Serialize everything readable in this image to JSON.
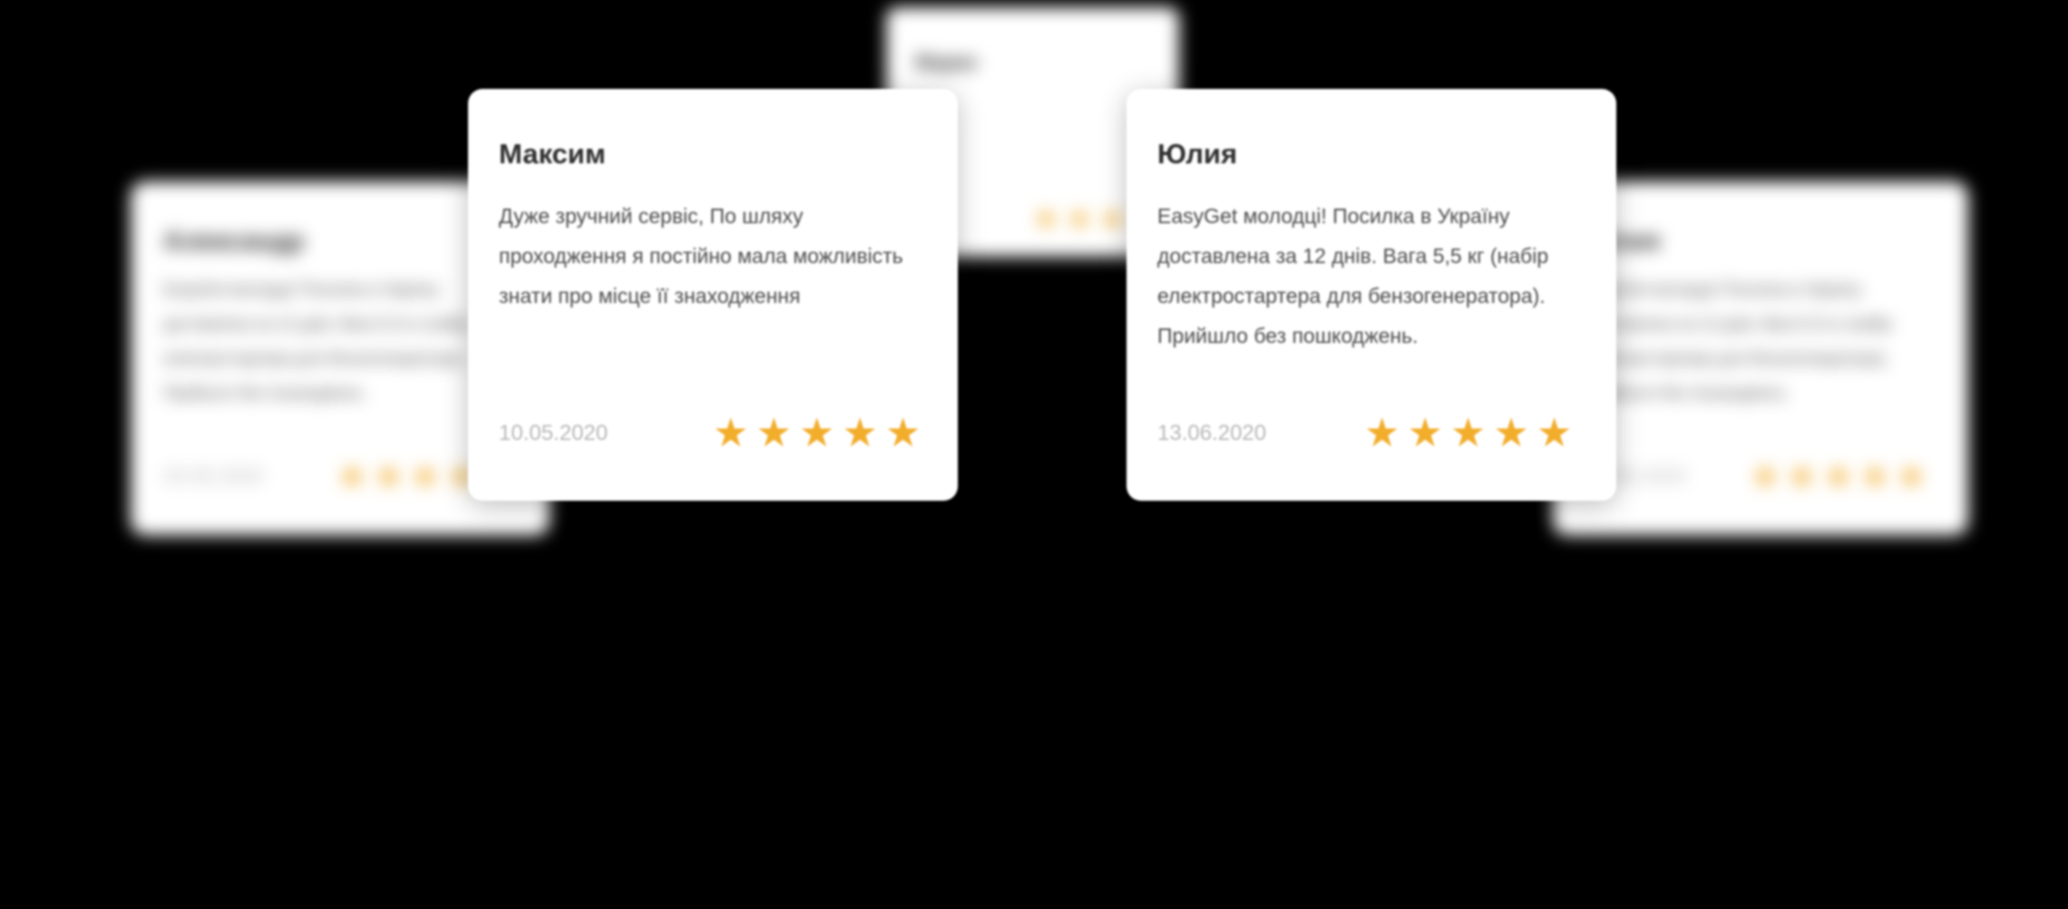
{
  "colors": {
    "background": "#000000",
    "card": "#ffffff",
    "star": "#f2ad2b",
    "date": "#b7b7b7"
  },
  "reviews": {
    "back": {
      "name": "Марко",
      "text": "",
      "date": "",
      "rating": 5
    },
    "left": {
      "name": "Александр",
      "text": "EasyGet молодці! Посилка в Україну доставлена за 12 днів. Вага 5,5 кг (набір електростартера для бензогенератора). Прийшло без пошкоджень.",
      "date": "20.05.2020",
      "rating": 5
    },
    "maxim": {
      "name": "Максим",
      "text": "Дуже зручний сервіс, По шляху проходження я постійно мала можливість знати про місце її знаходження",
      "date": "10.05.2020",
      "rating": 5
    },
    "yulia": {
      "name": "Юлия",
      "text": "EasyGet молодці! Посилка в Україну доставлена за 12 днів. Вага 5,5 кг (набір електростартера для бензогенератора). Прийшло без пошкоджень.",
      "date": "13.06.2020",
      "rating": 5
    },
    "right": {
      "name": "Юлия",
      "text": "EasyGet молодці! Посилка в Україну доставлена за 12 днів. Вага 5,5 кг (набір електростартера для бензогенератора). Прийшло без пошкоджень.",
      "date": "13.06.2020",
      "rating": 5
    }
  },
  "icons": {
    "star": "star-icon"
  }
}
